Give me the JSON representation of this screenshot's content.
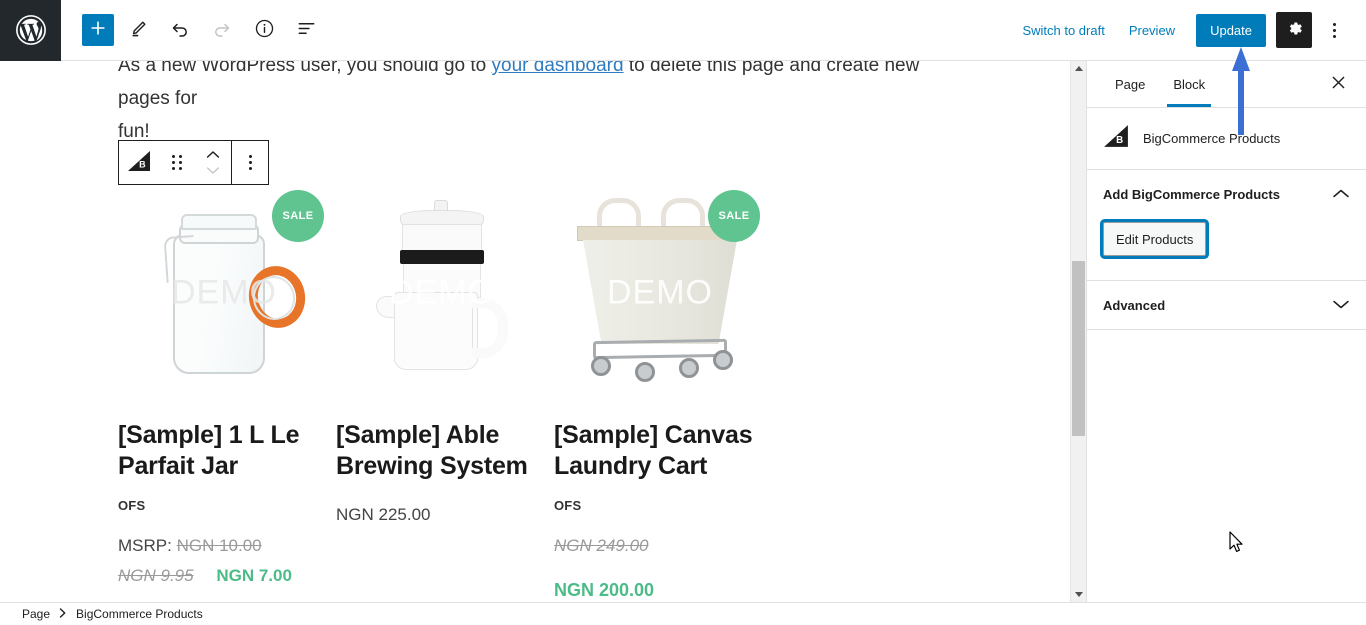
{
  "header": {
    "logo_icon": "wordpress-logo-icon",
    "tools": [
      {
        "name": "add-block-button",
        "icon": "plus-icon",
        "label": "+"
      },
      {
        "name": "edit-mode-button",
        "icon": "pencil-icon",
        "label": ""
      },
      {
        "name": "undo-button",
        "icon": "undo-arrow-icon",
        "label": ""
      },
      {
        "name": "redo-button",
        "icon": "redo-arrow-icon",
        "label": ""
      },
      {
        "name": "details-button",
        "icon": "info-circle-icon",
        "label": ""
      },
      {
        "name": "list-view-button",
        "icon": "list-view-icon",
        "label": ""
      }
    ],
    "switch_to_draft_label": "Switch to draft",
    "preview_label": "Preview",
    "update_label": "Update",
    "settings_icon": "gear-icon",
    "options_icon": "kebab-menu-icon"
  },
  "block_toolbar": {
    "block_icon": "bigcommerce-logo-icon",
    "drag_icon": "drag-handle-icon",
    "move_up_icon": "chevron-up-icon",
    "move_down_icon": "chevron-down-icon",
    "options_icon": "kebab-menu-icon"
  },
  "content": {
    "intro_text_before": "As a new WordPress user, you should go to ",
    "intro_link": "your dashboard",
    "intro_text_after": " to delete this page and create new pages for",
    "intro_text_line2": "fun!"
  },
  "products": [
    {
      "badge": "SALE",
      "has_badge": true,
      "watermark": "DEMO",
      "title": "[Sample] 1 L Le Parfait Jar",
      "brand": "OFS",
      "msrp_label": "MSRP:",
      "msrp_value": "NGN 10.00",
      "was_price": "NGN 9.95",
      "now_price": "NGN 7.00"
    },
    {
      "badge": "",
      "has_badge": false,
      "watermark": "DEMO",
      "title": "[Sample] Able Brewing System",
      "brand": "",
      "msrp_label": "",
      "msrp_value": "",
      "was_price": "",
      "now_price": "NGN 225.00"
    },
    {
      "badge": "SALE",
      "has_badge": true,
      "watermark": "DEMO",
      "title": "[Sample] Canvas Laundry Cart",
      "brand": "OFS",
      "msrp_label": "",
      "msrp_value": "",
      "was_price": "NGN 249.00",
      "now_price": "NGN 200.00"
    }
  ],
  "sidebar": {
    "tab_page_label": "Page",
    "tab_block_label": "Block",
    "active_tab": "Block",
    "close_icon": "close-icon",
    "block_icon": "bigcommerce-logo-icon",
    "block_name": "BigCommerce Products",
    "panels": [
      {
        "title": "Add BigCommerce Products",
        "expanded": true,
        "chevron_icon": "chevron-up-icon",
        "button_label": "Edit Products"
      },
      {
        "title": "Advanced",
        "expanded": false,
        "chevron_icon": "chevron-down-icon",
        "button_label": ""
      }
    ]
  },
  "breadcrumb": {
    "root_label": "Page",
    "separator": "›",
    "current_label": "BigCommerce Products"
  },
  "scrollbar": {
    "up_icon": "scroll-up-arrow-icon",
    "down_icon": "scroll-down-arrow-icon",
    "thumb_name": "scrollbar-thumb"
  },
  "annotation": {
    "arrow_icon": "blue-up-arrow-annotation",
    "arrow_color": "#3b6fd4"
  },
  "cursor": {
    "icon": "mouse-pointer-icon"
  },
  "colors": {
    "accent_blue": "#007cba",
    "sale_green": "#5fc48f",
    "price_green": "#4cbb87",
    "dark": "#1e1e1e",
    "annotation_blue": "#3b6fd4"
  }
}
